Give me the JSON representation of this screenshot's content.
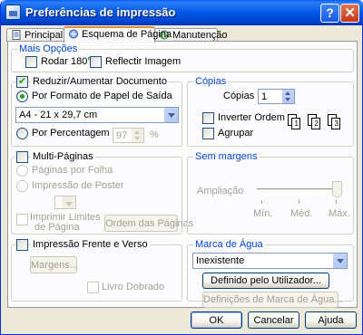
{
  "window": {
    "title": "Preferências de impressão",
    "help_glyph": "?",
    "close_glyph": "✕"
  },
  "tabs": [
    {
      "label": "Principal",
      "icon": "page-icon"
    },
    {
      "label": "Esquema de Página",
      "icon": "layout-icon",
      "active": true
    },
    {
      "label": "Manutenção",
      "icon": "maintenance-icon"
    }
  ],
  "mais_opcoes": {
    "legend": "Mais Opções",
    "rodar": "Rodar 180°",
    "reflectir": "Reflectir Imagem"
  },
  "reduzir": {
    "label": "Reduzir/Aumentar Documento",
    "por_formato": "Por Formato de Papel de Saída",
    "paper_value": "A4 - 21 x 29,7 cm",
    "por_percentagem": "Por Percentagem",
    "percent_value": "97",
    "percent_unit": "%"
  },
  "copias": {
    "legend": "Cópias",
    "label": "Cópias",
    "value": "1",
    "inverter": "Inverter Ordem",
    "agrupar": "Agrupar",
    "collate_pages": [
      "1",
      "2",
      "3"
    ]
  },
  "multi_paginas": {
    "label": "Multi-Páginas",
    "paginas_por_folha": "Páginas por Folha",
    "impressao_poster": "Impressão de Poster",
    "imprimir_limites_line1": "Imprimir Limites",
    "imprimir_limites_line2": "de Página",
    "ordem_button": "Ordem das Páginas"
  },
  "sem_margens": {
    "legend": "Sem margens",
    "ampliacao": "Ampliação",
    "ticks": [
      "Mín.",
      "Méd.",
      "Máx."
    ]
  },
  "frente_verso": {
    "label": "Impressão Frente e Verso",
    "margens_button": "Margens...",
    "livro_dobrado": "Livro Dobrado"
  },
  "marca_agua": {
    "legend": "Marca de Água",
    "selected": "Inexistente",
    "definido_button": "Definido pelo Utilizador...",
    "definicoes_button": "Definições de Marca de Água..."
  },
  "footer": {
    "ok": "OK",
    "cancelar": "Cancelar",
    "ajuda": "Ajuda"
  },
  "colors": {
    "title_bar": "#0054e3",
    "group_label": "#0046d5",
    "check_green": "#21a121",
    "dialog_bg": "#ece9d8"
  }
}
